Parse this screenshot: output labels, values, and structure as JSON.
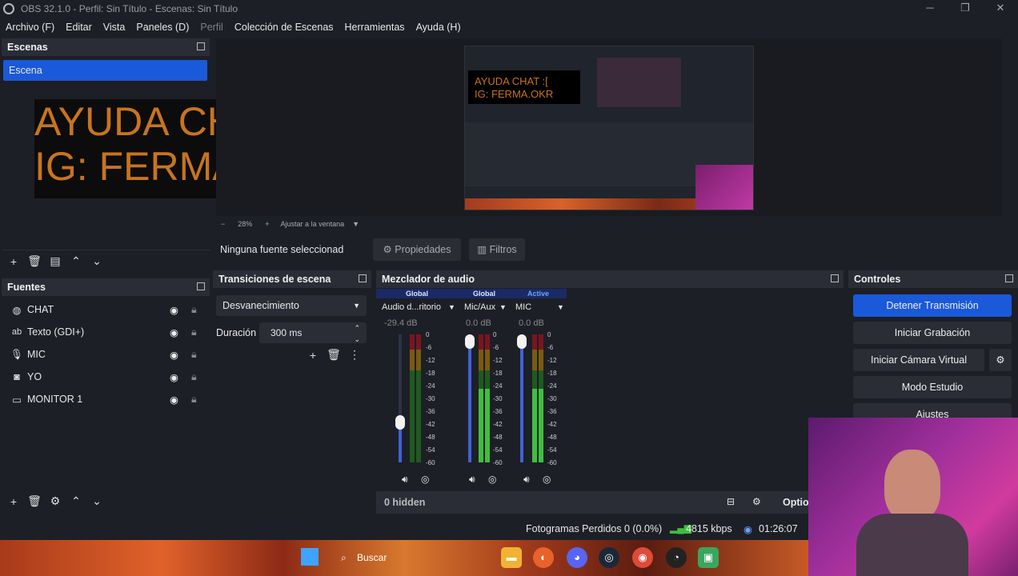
{
  "window": {
    "title": "OBS 32.1.0 - Perfil: Sin Título - Escenas: Sin Título"
  },
  "menu": [
    {
      "label": "Archivo (F)",
      "enabled": true
    },
    {
      "label": "Editar",
      "enabled": true
    },
    {
      "label": "Vista",
      "enabled": true
    },
    {
      "label": "Paneles (D)",
      "enabled": true
    },
    {
      "label": "Perfil",
      "enabled": false
    },
    {
      "label": "Colección de Escenas",
      "enabled": true
    },
    {
      "label": "Herramientas",
      "enabled": true
    },
    {
      "label": "Ayuda (H)",
      "enabled": true
    }
  ],
  "scenes": {
    "title": "Escenas",
    "items": [
      "Escena"
    ]
  },
  "overlay_text": {
    "line1": "AYUDA CHAT :[",
    "line2": "IG: FERMA.OKR"
  },
  "preview": {
    "zoom": "28%",
    "fit": "Ajustar a la ventana"
  },
  "context_bar": {
    "no_source": "Ninguna fuente seleccionad",
    "properties": "Propiedades",
    "filters": "Filtros"
  },
  "sources": {
    "title": "Fuentes",
    "items": [
      {
        "label": "CHAT",
        "icon": "browser-icon"
      },
      {
        "label": "Texto (GDI+)",
        "icon": "text-icon"
      },
      {
        "label": "MIC",
        "icon": "microphone-icon"
      },
      {
        "label": "YO",
        "icon": "camera-icon"
      },
      {
        "label": "MONITOR 1",
        "icon": "monitor-icon"
      }
    ]
  },
  "transitions": {
    "title": "Transiciones de escena",
    "selected": "Desvanecimiento",
    "duration_label": "Duración",
    "duration_value": "300 ms"
  },
  "mixer": {
    "title": "Mezclador de audio",
    "channels": [
      {
        "badge": "Global",
        "name": "Audio d...ritorio",
        "db": "-29.4 dB",
        "level": 0.3
      },
      {
        "badge": "Global",
        "name": "Mic/Aux",
        "db": "0.0 dB",
        "level": 1.0
      },
      {
        "badge": "Active",
        "name": "MIC",
        "db": "0.0 dB",
        "level": 1.0
      }
    ],
    "scale": [
      "0",
      "-6",
      "-12",
      "-18",
      "-24",
      "-30",
      "-36",
      "-42",
      "-48",
      "-54",
      "-60"
    ],
    "hidden": "0 hidden",
    "options": "Optio"
  },
  "controls": {
    "title": "Controles",
    "buttons": [
      "Detener Transmisión",
      "Iniciar Grabación",
      "Iniciar Cámara Virtual",
      "Modo Estudio",
      "Ajustes"
    ]
  },
  "status": {
    "dropped": "Fotogramas Perdidos 0 (0.0%)",
    "bitrate": "4815 kbps",
    "time": "01:26:07"
  },
  "taskbar": {
    "search": "Buscar"
  },
  "colors": {
    "accent": "#1a59d9",
    "overlay_text": "#c8741e",
    "meter_green": "#3fbf3f"
  }
}
